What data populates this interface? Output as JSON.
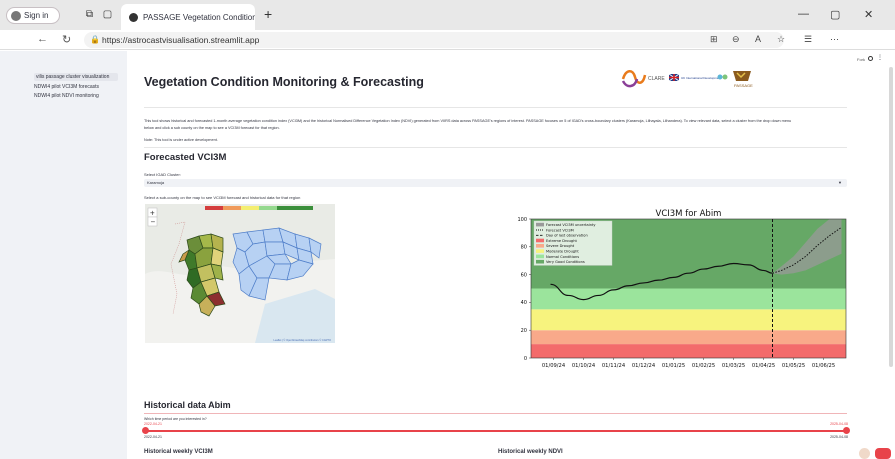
{
  "browser": {
    "signin": "Sign in",
    "tab_title": "PASSAGE Vegetation Condition D",
    "url": "https://astrocastvisualisation.streamlit.app"
  },
  "sidebar": {
    "items": [
      {
        "label": "vilis passage cluster visualization",
        "active": true
      },
      {
        "label": "NDWI4 pilot VCI3M forecasts"
      },
      {
        "label": "NDWI4 pilot NDVI monitoring"
      }
    ]
  },
  "main": {
    "top_right": "Fork",
    "title": "Vegetation Condition Monitoring & Forecasting",
    "logos": [
      "CLARE",
      "UK International Development",
      "PASSAGE"
    ],
    "intro": [
      "This tool shows historical and forecasted 1-month average vegetation condition index (VCI3M) and the historical Normalised Difference Vegetation Index (NDVI) generated from VIIRS data across PASSAGE's regions of interest. PASSAGE focuses on 5 of IGAD's cross-boundary clusters (Karamoja, Lilhayala, Lilhandera). To view relevant data, select a cluster from the drop down menu",
      "below and click a sub county on the map to see a VCI3M forecast for that region."
    ],
    "note": "Note: This tool is under active development.",
    "forecast_heading": "Forecasted VCI3M",
    "select_label": "Select IGAD Cluster:",
    "select_value": "Karamoja",
    "map_label": "Select a sub-county on the map to see VCI3M forecast and historical data for that region",
    "map_attribution": "Leaflet | © OpenStreetMap contributors © CARTO",
    "hist_heading": "Historical data Abim",
    "slider_label": "Which time period are you interested in?",
    "slider_from": "2022-04-21",
    "slider_to": "2025-04-08",
    "slider_min": "2022-04-21",
    "slider_max": "2025-04-08",
    "hist_vci": "Historical weekly VCI3M",
    "hist_ndvi": "Historical weekly NDVI"
  },
  "chart_data": {
    "type": "line",
    "title": "VCI3M for Abim",
    "ylim": [
      0,
      100
    ],
    "yticks": [
      0,
      20,
      40,
      60,
      80,
      100
    ],
    "x_labels": [
      "01/09/24",
      "01/10/24",
      "01/11/24",
      "01/12/24",
      "01/01/25",
      "01/02/25",
      "01/03/25",
      "01/04/25",
      "01/05/25",
      "01/06/25"
    ],
    "bands": [
      {
        "name": "Extreme Drought",
        "from": 0,
        "to": 10,
        "color": "#f36b6b"
      },
      {
        "name": "Severe Drought",
        "from": 10,
        "to": 20,
        "color": "#f9a98a"
      },
      {
        "name": "Moderate Drought",
        "from": 20,
        "to": 35,
        "color": "#f7f37e"
      },
      {
        "name": "Normal Conditions",
        "from": 35,
        "to": 50,
        "color": "#9be49c"
      },
      {
        "name": "Very Good Conditions",
        "from": 50,
        "to": 100,
        "color": "#66a866"
      }
    ],
    "legend": [
      "Forecast VCI3M uncertainty",
      "Forecast VCI3M",
      "Day of last observation",
      "Extreme Drought",
      "Severe Drought",
      "Moderate Drought",
      "Normal Conditions",
      "Very Good Conditions"
    ],
    "legend_position": "top-left",
    "last_observation_x": 7.3,
    "observed": {
      "x": [
        -0.1,
        0.5,
        1,
        1.5,
        2,
        2.5,
        3,
        3.5,
        4,
        4.5,
        5,
        5.5,
        6,
        6.5,
        7,
        7.3
      ],
      "y": [
        53,
        45,
        42,
        45,
        49,
        52,
        54,
        56,
        58,
        61,
        64,
        66,
        68,
        67,
        63,
        61
      ]
    },
    "forecast": {
      "x": [
        7.3,
        7.6,
        8,
        8.4,
        8.8,
        9.2,
        9.6
      ],
      "y": [
        61,
        63,
        67,
        73,
        81,
        88,
        94
      ]
    },
    "uncertainty": {
      "x": [
        7.3,
        7.6,
        8,
        8.4,
        8.8,
        9.2,
        9.6
      ],
      "low": [
        61,
        60,
        61,
        63,
        67,
        71,
        75
      ],
      "high": [
        61,
        66,
        73,
        83,
        93,
        100,
        100
      ]
    }
  }
}
